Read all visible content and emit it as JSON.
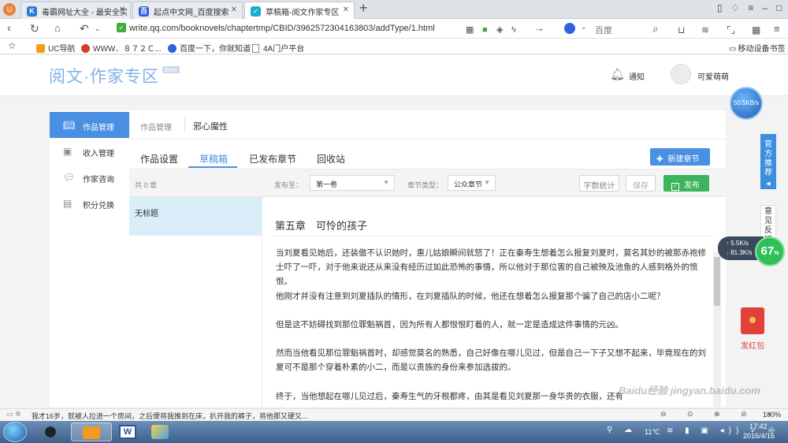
{
  "tabs": [
    {
      "title": "毒霸网址大全 - 最安全实",
      "fav": "K",
      "color": "#2b79d6"
    },
    {
      "title": "起点中文网_百度搜索",
      "fav": "百",
      "color": "#3060e0"
    },
    {
      "title": "草稿箱-阅文作家专区",
      "fav": "✓",
      "color": "#1aaed6"
    }
  ],
  "new_tab": "+",
  "address": {
    "url": "write.qq.com/booknovels/chaptertmp/CBID/3962572304163803/addType/1.html",
    "search_engine": "百度"
  },
  "bookmarks": [
    {
      "label": "UC导航"
    },
    {
      "label": "WWW．８７２Ｃ..."
    },
    {
      "label": "百度一下，你就知道"
    },
    {
      "label": "4A门户平台"
    }
  ],
  "bookmarks_right": "移动设备书签",
  "site": {
    "logo": "阅文·作家专区",
    "beta": "beta",
    "notify": "通知",
    "username": "可爱萌萌"
  },
  "sidebar": {
    "items": [
      {
        "label": "作品管理",
        "icon": "book-icon"
      },
      {
        "label": "收入管理",
        "icon": "wallet-icon"
      },
      {
        "label": "作家咨询",
        "icon": "chat-icon"
      },
      {
        "label": "积分兑换",
        "icon": "gift-icon"
      }
    ]
  },
  "breadcrumb": {
    "root": "作品管理",
    "book": "邪心魔性"
  },
  "content_tabs": [
    "作品设置",
    "草稿箱",
    "已发布章节",
    "回收站"
  ],
  "new_chapter": "新建章节",
  "drafts": {
    "count": "共 0 章",
    "item": "无标题"
  },
  "toolbar": {
    "publish_to_label": "发布至：",
    "volume": "第一卷",
    "chapter_type_label": "章节类型：",
    "chapter_type": "公众章节",
    "word_count": "字数统计",
    "save": "保存",
    "publish": "发布"
  },
  "chapter": {
    "title": "第五章　可怜的孩子",
    "paragraphs": [
      "当刘夏看见她后，还装傲不认识她时，惠儿姑娘瞬间就怒了！正在秦寿生想着怎么报复刘夏时，莫名其妙的被那赤袍修士吓了一吓，对于他来说还从来没有经历过如此恐怖的事情，所以他对于那位害的自己被殃及池鱼的人感到格外的愤恨。",
      "他刚才并没有注意到刘夏插队的情形，在刘夏插队的时候，他还在想着怎么报复那个骗了自己的店小二呢？",
      "但是这不妨碍找到那位罪魁祸首，因为所有人都恨恨盯着的人，就一定是造成这件事情的元凶。",
      "然而当他看见那位罪魁祸首时，却感觉莫名的熟悉，自己好像在哪儿见过，但是自己一下子又想不起来，毕竟现在的刘夏可不是那个穿着朴素的小二，而是以贵族的身份来参加选拔的。",
      "终于，当他想起在哪儿见过后，秦寿生气的牙根都疼，由其是看见刘夏那一身华贵的衣服，还有"
    ]
  },
  "right_widgets": {
    "speed": "50.5KB/s",
    "official": "官方推荐",
    "feedback": "意见反馈",
    "up": "5.5K/s",
    "down": "81.3K/s",
    "percent": "67",
    "percent_unit": "%",
    "red_packet": "发红包"
  },
  "status": {
    "news": "我才16岁，就被人拉进一个房间，之后便将我推到在床，扒开我的裤子，将他那又硬又...",
    "zoom": "100%"
  },
  "taskbar": {
    "temp": "11℃",
    "time": "17:42",
    "date": "2016/4/16"
  },
  "watermark": "Baidu经验 jingyan.baidu.com"
}
